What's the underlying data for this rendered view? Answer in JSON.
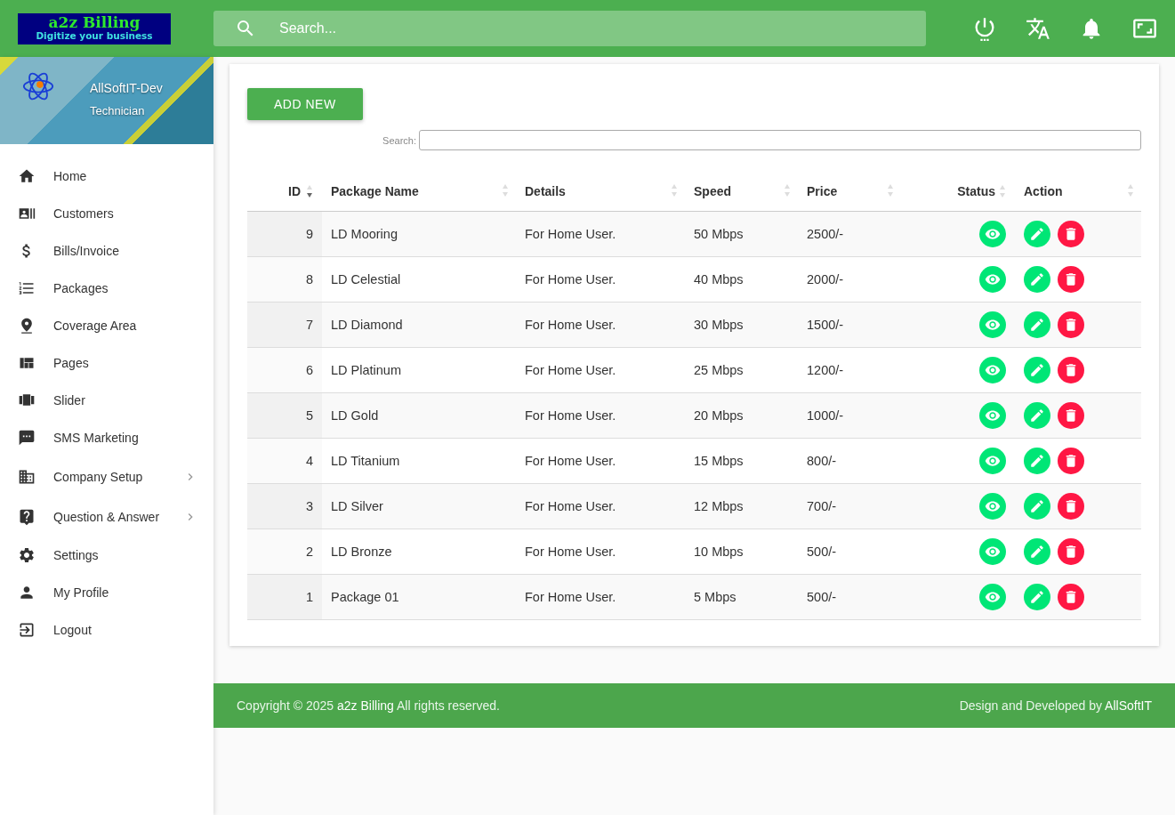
{
  "logo": {
    "title": "a2z Billing",
    "tagline": "Digitize your business"
  },
  "search": {
    "placeholder": "Search..."
  },
  "user": {
    "name": "AllSoftIT-Dev",
    "role": "Technician"
  },
  "sidebar": {
    "items": [
      {
        "label": "Home",
        "expandable": false
      },
      {
        "label": "Customers",
        "expandable": false
      },
      {
        "label": "Bills/Invoice",
        "expandable": false
      },
      {
        "label": "Packages",
        "expandable": false
      },
      {
        "label": "Coverage Area",
        "expandable": false
      },
      {
        "label": "Pages",
        "expandable": false
      },
      {
        "label": "Slider",
        "expandable": false
      },
      {
        "label": "SMS Marketing",
        "expandable": false
      },
      {
        "label": "Company Setup",
        "expandable": true
      },
      {
        "label": "Question & Answer",
        "expandable": true
      },
      {
        "label": "Settings",
        "expandable": false
      },
      {
        "label": "My Profile",
        "expandable": false
      },
      {
        "label": "Logout",
        "expandable": false
      }
    ]
  },
  "add_button": "ADD NEW",
  "table_search": {
    "label": "Search:"
  },
  "table": {
    "columns": [
      {
        "label": "ID",
        "sorted": true
      },
      {
        "label": "Package Name",
        "sorted": false
      },
      {
        "label": "Details",
        "sorted": false
      },
      {
        "label": "Speed",
        "sorted": false
      },
      {
        "label": "Price",
        "sorted": false
      },
      {
        "label": "Status",
        "sorted": false
      },
      {
        "label": "Action",
        "sorted": false
      }
    ],
    "rows": [
      {
        "id": "9",
        "name": "LD Mooring",
        "details": "For Home User.",
        "speed": "50 Mbps",
        "price": "2500/-"
      },
      {
        "id": "8",
        "name": "LD Celestial",
        "details": "For Home User.",
        "speed": "40 Mbps",
        "price": "2000/-"
      },
      {
        "id": "7",
        "name": "LD Diamond",
        "details": "For Home User.",
        "speed": "30 Mbps",
        "price": "1500/-"
      },
      {
        "id": "6",
        "name": "LD Platinum",
        "details": "For Home User.",
        "speed": "25 Mbps",
        "price": "1200/-"
      },
      {
        "id": "5",
        "name": "LD Gold",
        "details": "For Home User.",
        "speed": "20 Mbps",
        "price": "1000/-"
      },
      {
        "id": "4",
        "name": "LD Titanium",
        "details": "For Home User.",
        "speed": "15 Mbps",
        "price": "800/-"
      },
      {
        "id": "3",
        "name": "LD Silver",
        "details": "For Home User.",
        "speed": "12 Mbps",
        "price": "700/-"
      },
      {
        "id": "2",
        "name": "LD Bronze",
        "details": "For Home User.",
        "speed": "10 Mbps",
        "price": "500/-"
      },
      {
        "id": "1",
        "name": "Package 01",
        "details": "For Home User.",
        "speed": "5 Mbps",
        "price": "500/-"
      }
    ]
  },
  "footer": {
    "copyright_prefix": "Copyright © 2025",
    "copyright_link": "a2z Billing",
    "copyright_suffix": "All rights reserved.",
    "credit_prefix": "Design and Developed by",
    "credit_link": "AllSoftIT"
  }
}
